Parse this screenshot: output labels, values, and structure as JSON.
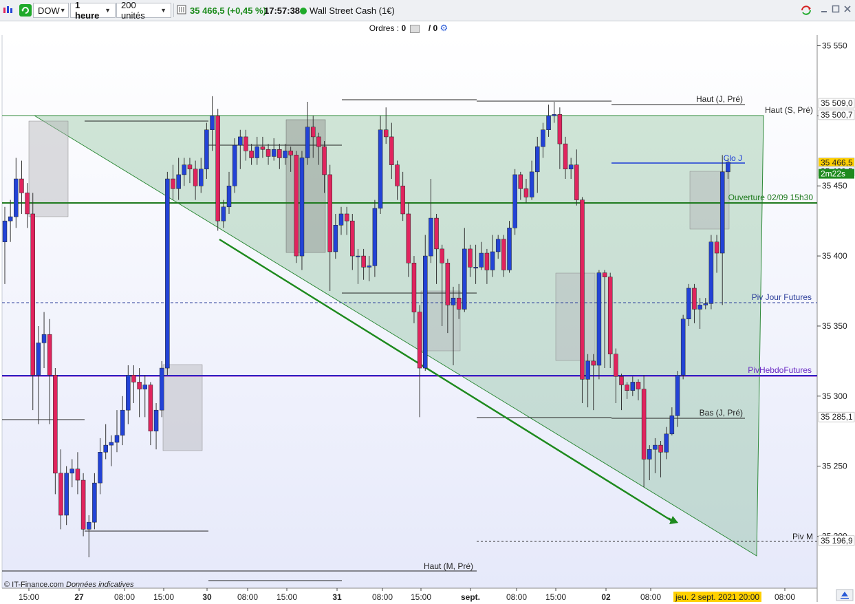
{
  "toolbar": {
    "symbol": "DOW",
    "timeframe": "1 heure",
    "units": "200 unités",
    "price_change": "35 466,5 (+0,45 %)",
    "time": "17:57:38",
    "instrument": "Wall Street Cash (1€)",
    "status_color": "#1faa2a",
    "icons": [
      "chart-type-icon",
      "refresh-icon",
      "settings-icon",
      "minimize-icon",
      "maximize-icon",
      "close-icon"
    ]
  },
  "orders": {
    "label": "Ordres :",
    "left_count": "0",
    "right_count": "/ 0"
  },
  "price_axis": {
    "ticks": [
      35550,
      35500,
      35450,
      35400,
      35350,
      35300,
      35250,
      35200
    ],
    "tick_labels": [
      "35 550",
      "35 500",
      "35 450",
      "35 400",
      "35 350",
      "35 300",
      "35 250",
      "35 200"
    ],
    "markers": [
      {
        "price": 35509.0,
        "label": "35 509,0",
        "bg": "#ffffff"
      },
      {
        "price": 35500.7,
        "label": "35 500,7",
        "bg": "#ffffff"
      },
      {
        "price": 35466.5,
        "label": "35 466,5",
        "bg": "#ffd000"
      },
      {
        "price": 35460.5,
        "label": "35 460,5",
        "bg": "#eaf0ff"
      },
      {
        "price": 35285.1,
        "label": "35 285,1",
        "bg": "#ffffff"
      },
      {
        "price": 35196.9,
        "label": "35 196,9",
        "bg": "#ffffff"
      }
    ],
    "countdown": "2m22s"
  },
  "time_axis": {
    "labels": [
      "15:00",
      "27",
      "08:00",
      "15:00",
      "30",
      "08:00",
      "15:00",
      "31",
      "08:00",
      "15:00",
      "sept.",
      "08:00",
      "15:00",
      "02",
      "08:00",
      "08:00"
    ],
    "current": "jeu. 2 sept. 2021 20:00"
  },
  "annotations": {
    "haut_j": "Haut (J, Pré)",
    "haut_s": "Haut (S, Pré)",
    "clo_j": "Clo J",
    "ouverture": "Ouverture 02/09 15h30",
    "piv_jour": "Piv Jour Futures",
    "overlap": "PivHebdoFutures",
    "bas_j": "Bas (J, Pré)",
    "piv_m": "Piv M",
    "haut_m": "Haut (M, Pré)"
  },
  "footer": {
    "copyright": "© IT-Finance.com",
    "note": "Données indicatives"
  },
  "chart_data": {
    "type": "candlestick",
    "up_color": "#2343d6",
    "down_color": "#e0245e",
    "candles": [
      {
        "o": 35410,
        "c": 35425,
        "h": 35435,
        "l": 35380
      },
      {
        "o": 35425,
        "c": 35428,
        "h": 35440,
        "l": 35410
      },
      {
        "o": 35428,
        "c": 35455,
        "h": 35470,
        "l": 35420
      },
      {
        "o": 35455,
        "c": 35445,
        "h": 35468,
        "l": 35430
      },
      {
        "o": 35445,
        "c": 35430,
        "h": 35452,
        "l": 35420
      },
      {
        "o": 35430,
        "c": 35315,
        "h": 35445,
        "l": 35290
      },
      {
        "o": 35315,
        "c": 35338,
        "h": 35350,
        "l": 35280
      },
      {
        "o": 35338,
        "c": 35344,
        "h": 35360,
        "l": 35320
      },
      {
        "o": 35344,
        "c": 35315,
        "h": 35355,
        "l": 35280
      },
      {
        "o": 35315,
        "c": 35245,
        "h": 35320,
        "l": 35230
      },
      {
        "o": 35245,
        "c": 35215,
        "h": 35262,
        "l": 35205
      },
      {
        "o": 35215,
        "c": 35245,
        "h": 35250,
        "l": 35208
      },
      {
        "o": 35245,
        "c": 35248,
        "h": 35255,
        "l": 35235
      },
      {
        "o": 35248,
        "c": 35240,
        "h": 35260,
        "l": 35230
      },
      {
        "o": 35240,
        "c": 35205,
        "h": 35245,
        "l": 35200
      },
      {
        "o": 35205,
        "c": 35210,
        "h": 35215,
        "l": 35185
      },
      {
        "o": 35210,
        "c": 35238,
        "h": 35245,
        "l": 35205
      },
      {
        "o": 35238,
        "c": 35260,
        "h": 35270,
        "l": 35230
      },
      {
        "o": 35260,
        "c": 35265,
        "h": 35280,
        "l": 35255
      },
      {
        "o": 35265,
        "c": 35267,
        "h": 35272,
        "l": 35250
      },
      {
        "o": 35267,
        "c": 35272,
        "h": 35290,
        "l": 35260
      },
      {
        "o": 35272,
        "c": 35290,
        "h": 35300,
        "l": 35265
      },
      {
        "o": 35290,
        "c": 35315,
        "h": 35322,
        "l": 35280
      },
      {
        "o": 35315,
        "c": 35310,
        "h": 35322,
        "l": 35295
      },
      {
        "o": 35310,
        "c": 35305,
        "h": 35320,
        "l": 35285
      },
      {
        "o": 35305,
        "c": 35308,
        "h": 35315,
        "l": 35285
      },
      {
        "o": 35308,
        "c": 35275,
        "h": 35310,
        "l": 35265
      },
      {
        "o": 35275,
        "c": 35290,
        "h": 35295,
        "l": 35262
      },
      {
        "o": 35290,
        "c": 35320,
        "h": 35325,
        "l": 35285
      },
      {
        "o": 35320,
        "c": 35455,
        "h": 35460,
        "l": 35315
      },
      {
        "o": 35455,
        "c": 35448,
        "h": 35465,
        "l": 35440
      },
      {
        "o": 35448,
        "c": 35458,
        "h": 35470,
        "l": 35440
      },
      {
        "o": 35458,
        "c": 35465,
        "h": 35470,
        "l": 35450
      },
      {
        "o": 35465,
        "c": 35462,
        "h": 35470,
        "l": 35452
      },
      {
        "o": 35462,
        "c": 35450,
        "h": 35468,
        "l": 35440
      },
      {
        "o": 35450,
        "c": 35462,
        "h": 35470,
        "l": 35445
      },
      {
        "o": 35462,
        "c": 35490,
        "h": 35495,
        "l": 35455
      },
      {
        "o": 35490,
        "c": 35500,
        "h": 35514,
        "l": 35475
      },
      {
        "o": 35500,
        "c": 35425,
        "h": 35505,
        "l": 35418
      },
      {
        "o": 35425,
        "c": 35435,
        "h": 35440,
        "l": 35420
      },
      {
        "o": 35435,
        "c": 35450,
        "h": 35460,
        "l": 35430
      },
      {
        "o": 35450,
        "c": 35479,
        "h": 35484,
        "l": 35445
      },
      {
        "o": 35479,
        "c": 35485,
        "h": 35490,
        "l": 35462
      },
      {
        "o": 35485,
        "c": 35475,
        "h": 35490,
        "l": 35468
      },
      {
        "o": 35475,
        "c": 35470,
        "h": 35480,
        "l": 35465
      },
      {
        "o": 35470,
        "c": 35478,
        "h": 35485,
        "l": 35465
      },
      {
        "o": 35478,
        "c": 35476,
        "h": 35485,
        "l": 35470
      },
      {
        "o": 35476,
        "c": 35471,
        "h": 35480,
        "l": 35465
      },
      {
        "o": 35471,
        "c": 35476,
        "h": 35484,
        "l": 35468
      },
      {
        "o": 35476,
        "c": 35470,
        "h": 35480,
        "l": 35462
      },
      {
        "o": 35470,
        "c": 35475,
        "h": 35480,
        "l": 35465
      },
      {
        "o": 35475,
        "c": 35472,
        "h": 35478,
        "l": 35460
      },
      {
        "o": 35472,
        "c": 35400,
        "h": 35475,
        "l": 35395
      },
      {
        "o": 35400,
        "c": 35470,
        "h": 35475,
        "l": 35390
      },
      {
        "o": 35470,
        "c": 35492,
        "h": 35510,
        "l": 35465
      },
      {
        "o": 35492,
        "c": 35485,
        "h": 35500,
        "l": 35470
      },
      {
        "o": 35485,
        "c": 35478,
        "h": 35488,
        "l": 35465
      },
      {
        "o": 35478,
        "c": 35458,
        "h": 35482,
        "l": 35445
      },
      {
        "o": 35458,
        "c": 35403,
        "h": 35465,
        "l": 35375
      },
      {
        "o": 35403,
        "c": 35422,
        "h": 35430,
        "l": 35398
      },
      {
        "o": 35422,
        "c": 35430,
        "h": 35435,
        "l": 35415
      },
      {
        "o": 35430,
        "c": 35425,
        "h": 35435,
        "l": 35415
      },
      {
        "o": 35425,
        "c": 35400,
        "h": 35430,
        "l": 35390
      },
      {
        "o": 35400,
        "c": 35400,
        "h": 35405,
        "l": 35380
      },
      {
        "o": 35400,
        "c": 35392,
        "h": 35405,
        "l": 35383
      },
      {
        "o": 35392,
        "c": 35393,
        "h": 35400,
        "l": 35382
      },
      {
        "o": 35393,
        "c": 35434,
        "h": 35440,
        "l": 35385
      },
      {
        "o": 35434,
        "c": 35490,
        "h": 35500,
        "l": 35430
      },
      {
        "o": 35490,
        "c": 35485,
        "h": 35506,
        "l": 35480
      },
      {
        "o": 35485,
        "c": 35465,
        "h": 35495,
        "l": 35455
      },
      {
        "o": 35465,
        "c": 35450,
        "h": 35468,
        "l": 35440
      },
      {
        "o": 35450,
        "c": 35430,
        "h": 35460,
        "l": 35425
      },
      {
        "o": 35430,
        "c": 35395,
        "h": 35438,
        "l": 35385
      },
      {
        "o": 35395,
        "c": 35360,
        "h": 35400,
        "l": 35352
      },
      {
        "o": 35360,
        "c": 35320,
        "h": 35365,
        "l": 35285
      },
      {
        "o": 35320,
        "c": 35400,
        "h": 35415,
        "l": 35318
      },
      {
        "o": 35400,
        "c": 35427,
        "h": 35455,
        "l": 35395
      },
      {
        "o": 35427,
        "c": 35405,
        "h": 35430,
        "l": 35380
      },
      {
        "o": 35405,
        "c": 35395,
        "h": 35408,
        "l": 35350
      },
      {
        "o": 35395,
        "c": 35365,
        "h": 35398,
        "l": 35345
      },
      {
        "o": 35365,
        "c": 35370,
        "h": 35378,
        "l": 35322
      },
      {
        "o": 35370,
        "c": 35362,
        "h": 35380,
        "l": 35355
      },
      {
        "o": 35362,
        "c": 35405,
        "h": 35420,
        "l": 35360
      },
      {
        "o": 35405,
        "c": 35392,
        "h": 35408,
        "l": 35385
      },
      {
        "o": 35392,
        "c": 35392,
        "h": 35408,
        "l": 35380
      },
      {
        "o": 35392,
        "c": 35402,
        "h": 35410,
        "l": 35390
      },
      {
        "o": 35402,
        "c": 35390,
        "h": 35405,
        "l": 35380
      },
      {
        "o": 35390,
        "c": 35403,
        "h": 35415,
        "l": 35385
      },
      {
        "o": 35403,
        "c": 35412,
        "h": 35415,
        "l": 35398
      },
      {
        "o": 35412,
        "c": 35390,
        "h": 35415,
        "l": 35385
      },
      {
        "o": 35390,
        "c": 35420,
        "h": 35425,
        "l": 35388
      },
      {
        "o": 35420,
        "c": 35458,
        "h": 35462,
        "l": 35415
      },
      {
        "o": 35458,
        "c": 35448,
        "h": 35460,
        "l": 35440
      },
      {
        "o": 35448,
        "c": 35442,
        "h": 35455,
        "l": 35438
      },
      {
        "o": 35442,
        "c": 35460,
        "h": 35468,
        "l": 35440
      },
      {
        "o": 35460,
        "c": 35478,
        "h": 35485,
        "l": 35445
      },
      {
        "o": 35478,
        "c": 35490,
        "h": 35495,
        "l": 35470
      },
      {
        "o": 35490,
        "c": 35500,
        "h": 35508,
        "l": 35485
      },
      {
        "o": 35500,
        "c": 35501,
        "h": 35510,
        "l": 35495
      },
      {
        "o": 35501,
        "c": 35480,
        "h": 35506,
        "l": 35462
      },
      {
        "o": 35480,
        "c": 35462,
        "h": 35485,
        "l": 35455
      },
      {
        "o": 35462,
        "c": 35465,
        "h": 35470,
        "l": 35455
      },
      {
        "o": 35465,
        "c": 35440,
        "h": 35476,
        "l": 35436
      },
      {
        "o": 35440,
        "c": 35312,
        "h": 35442,
        "l": 35295
      },
      {
        "o": 35312,
        "c": 35325,
        "h": 35330,
        "l": 35292
      },
      {
        "o": 35325,
        "c": 35322,
        "h": 35330,
        "l": 35290
      },
      {
        "o": 35322,
        "c": 35388,
        "h": 35390,
        "l": 35312
      },
      {
        "o": 35388,
        "c": 35385,
        "h": 35390,
        "l": 35320
      },
      {
        "o": 35385,
        "c": 35330,
        "h": 35388,
        "l": 35320
      },
      {
        "o": 35330,
        "c": 35314,
        "h": 35334,
        "l": 35295
      },
      {
        "o": 35314,
        "c": 35308,
        "h": 35316,
        "l": 35290
      },
      {
        "o": 35308,
        "c": 35304,
        "h": 35310,
        "l": 35298
      },
      {
        "o": 35304,
        "c": 35310,
        "h": 35314,
        "l": 35300
      },
      {
        "o": 35310,
        "c": 35305,
        "h": 35312,
        "l": 35297
      },
      {
        "o": 35305,
        "c": 35255,
        "h": 35315,
        "l": 35235
      },
      {
        "o": 35255,
        "c": 35262,
        "h": 35265,
        "l": 35240
      },
      {
        "o": 35262,
        "c": 35265,
        "h": 35270,
        "l": 35245
      },
      {
        "o": 35265,
        "c": 35260,
        "h": 35268,
        "l": 35242
      },
      {
        "o": 35260,
        "c": 35273,
        "h": 35278,
        "l": 35255
      },
      {
        "o": 35273,
        "c": 35286,
        "h": 35292,
        "l": 35272
      },
      {
        "o": 35286,
        "c": 35315,
        "h": 35318,
        "l": 35278
      },
      {
        "o": 35315,
        "c": 35355,
        "h": 35358,
        "l": 35312
      },
      {
        "o": 35355,
        "c": 35377,
        "h": 35380,
        "l": 35350
      },
      {
        "o": 35377,
        "c": 35362,
        "h": 35380,
        "l": 35352
      },
      {
        "o": 35362,
        "c": 35365,
        "h": 35370,
        "l": 35348
      },
      {
        "o": 35365,
        "c": 35366,
        "h": 35370,
        "l": 35362
      },
      {
        "o": 35366,
        "c": 35410,
        "h": 35415,
        "l": 35362
      },
      {
        "o": 35410,
        "c": 35402,
        "h": 35415,
        "l": 35388
      },
      {
        "o": 35402,
        "c": 35460,
        "h": 35472,
        "l": 35365
      },
      {
        "o": 35460,
        "c": 35467,
        "h": 35470,
        "l": 35455
      }
    ]
  }
}
